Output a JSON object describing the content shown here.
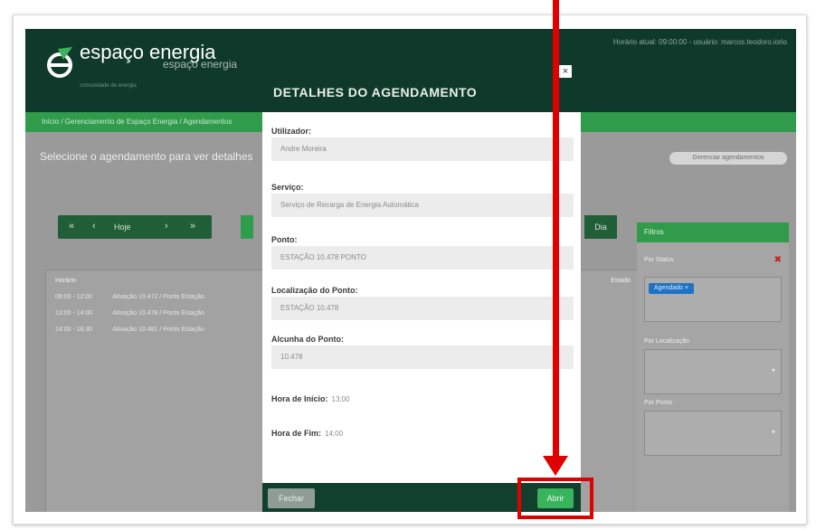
{
  "app": {
    "brand_logo_text": "espaço energia",
    "brand_logo_sub": "comunidade de energia",
    "brand_label": "espaço energia",
    "top_info": "Horário atual: 09:00:00 - usuário: marcos.teodoro.iorio",
    "breadcrumb": "Início / Gerenciamento de Espaço Energia / Agendamentos",
    "page_title": "Selecione o agendamento para ver detalhes",
    "top_right_button": "Gerenciar agendamentos",
    "pager": {
      "first": "«",
      "prev": "‹",
      "label": "Hoje",
      "next": "›",
      "last": "»"
    },
    "day_button": "Dia",
    "event_header": "Horário",
    "event_header_right": "Estado",
    "events": [
      {
        "time": "09:00 - 12:00",
        "text": "Ativação 10.472 / Ponto Estação"
      },
      {
        "time": "13:00 - 14:00",
        "text": "Ativação 10.478 / Ponto Estação"
      },
      {
        "time": "14:00 - 16:30",
        "text": "Ativação 10.481 / Ponto Estação"
      }
    ],
    "filter": {
      "title": "Filtros",
      "status_label": "Por Status",
      "remove_icon": "✖",
      "tag": "Agendado ×",
      "location_label": "Por Localização",
      "point_label": "Por Ponto"
    }
  },
  "modal": {
    "title": "DETALHES DO AGENDAMENTO",
    "close": "×",
    "fields": {
      "user_label": "Utilizador:",
      "user_value": "Andre Moreira",
      "service_label": "Serviço:",
      "service_value": "Serviço de Recarga de Energia Automática",
      "point_label": "Ponto:",
      "point_value": "ESTAÇÃO 10.478 PONTO",
      "location_label": "Localização do Ponto:",
      "location_value": "ESTAÇÃO 10.478",
      "nickname_label": "Alcunha do Ponto:",
      "nickname_value": "10.478",
      "start_label": "Hora de Início:",
      "start_value": "13:00",
      "end_label": "Hora de Fim:",
      "end_value": "14:00"
    },
    "buttons": {
      "close": "Fechar",
      "open": "Abrir"
    }
  },
  "annotation": {
    "color": "#e00000"
  }
}
